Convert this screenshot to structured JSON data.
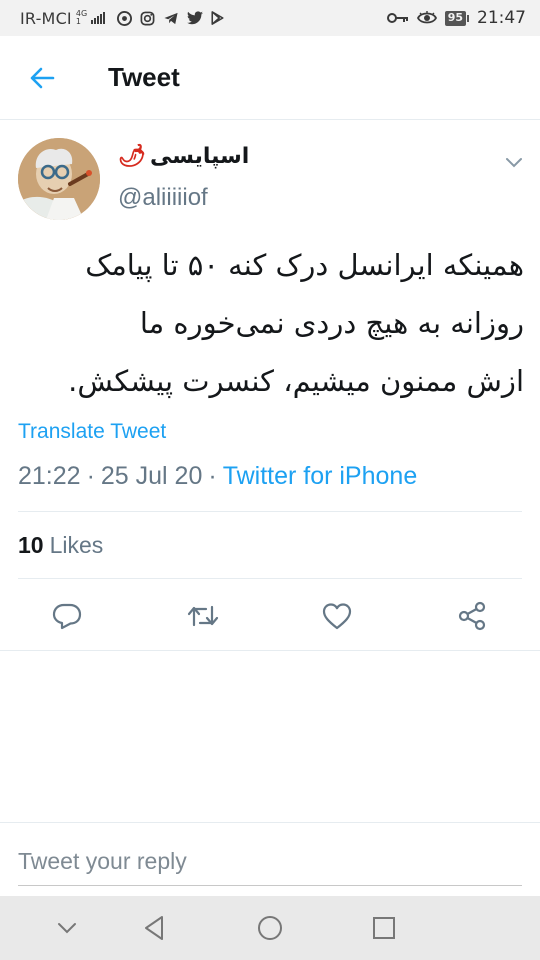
{
  "status_bar": {
    "carrier": "IR-MCI",
    "network_type": "4G",
    "network_sub": "1",
    "battery": "95",
    "time": "21:47",
    "icons": [
      "chrome-icon",
      "instagram-icon",
      "telegram-icon",
      "twitter-icon",
      "play-store-icon",
      "key-icon",
      "eye-icon"
    ]
  },
  "header": {
    "title": "Tweet",
    "back_icon": "arrow-left-icon"
  },
  "tweet": {
    "author_name": "اسپایسی",
    "author_emoji": "🌶",
    "handle": "@aliiiiiof",
    "text_lines": [
      "همینکه ایرانسل درک کنه ۵۰ تا پیامک",
      "روزانه به هیچ دردی نمی‌خوره ما",
      "ازش ممنون میشیم، کنسرت پیشکش."
    ],
    "translate_label": "Translate Tweet",
    "time": "21:22",
    "separator": "·",
    "date": "25 Jul 20",
    "source": "Twitter for iPhone",
    "likes_count": "10",
    "likes_label": "Likes",
    "actions": [
      "reply-icon",
      "retweet-icon",
      "like-icon",
      "share-icon"
    ]
  },
  "reply": {
    "placeholder": "Tweet your reply"
  },
  "nav_bar": {
    "buttons": [
      "collapse-icon",
      "back-triangle-icon",
      "home-circle-icon",
      "recents-square-icon"
    ]
  },
  "colors": {
    "accent": "#1da1f2",
    "muted": "#657786",
    "text": "#14171a",
    "divider": "#e6ecf0"
  }
}
